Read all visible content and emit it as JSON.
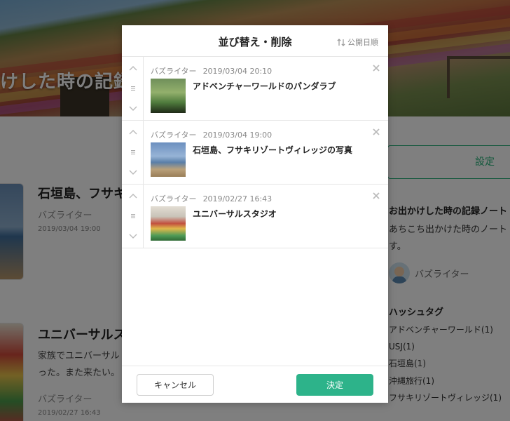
{
  "background": {
    "hero_title": "けした時の記録",
    "articles": [
      {
        "title": "石垣島、フサキ",
        "excerpt_lines": [],
        "author": "バズライター",
        "date": "2019/03/04 19:00"
      },
      {
        "title": "ユニバーサルス",
        "excerpt_lines": [
          "家族でユニバーサル",
          "った。また来たい。"
        ],
        "author": "バズライター",
        "date": "2019/02/27 16:43"
      }
    ],
    "sidebar": {
      "settings_label": "設定",
      "blog_title": "お出かけした時の記録ノート",
      "blog_desc_lines": [
        "あちこち出かけた時のノート",
        "す。"
      ],
      "author": "バズライター",
      "hashtag_heading": "ハッシュタグ",
      "hashtags": [
        "アドベンチャーワールド(1)",
        "USJ(1)",
        "石垣島(1)",
        "沖縄旅行(1)",
        "フサキリゾートヴィレッジ(1)"
      ]
    }
  },
  "modal": {
    "title": "並び替え・削除",
    "sort_label": "公開日順",
    "items": [
      {
        "author": "バズライター",
        "date": "2019/03/04 20:10",
        "title": "アドベンチャーワールドのパンダラブ"
      },
      {
        "author": "バズライター",
        "date": "2019/03/04 19:00",
        "title": "石垣島、フサキリゾートヴィレッジの写真"
      },
      {
        "author": "バズライター",
        "date": "2019/02/27 16:43",
        "title": "ユニバーサルスタジオ"
      }
    ],
    "cancel_label": "キャンセル",
    "ok_label": "決定"
  },
  "colors": {
    "accent": "#2db38a",
    "overlay": "rgba(0,0,0,0.5)"
  },
  "icons": [
    "chevron-up-icon",
    "drag-handle-icon",
    "chevron-down-icon",
    "close-icon",
    "sort-icon"
  ]
}
